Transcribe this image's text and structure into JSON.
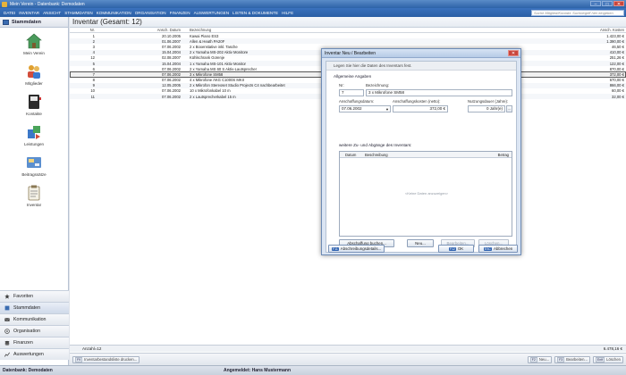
{
  "window": {
    "title": "Mein Verein - Datenbank: Demodaten",
    "controls": [
      "–",
      "□",
      "✕"
    ]
  },
  "menu": {
    "items": [
      "Datei",
      "Inventar",
      "Ansicht",
      "Stammdaten",
      "Kommunikation",
      "Organisation",
      "Finanzen",
      "Auswertungen",
      "Listen & Dokumente",
      "Hilfe"
    ],
    "search_placeholder": "Suche Mitglied/Kontakt: Suchbegriff hier eingeben"
  },
  "sidebar": {
    "header": "Stammdaten",
    "modules": [
      {
        "label": "Mein Verein",
        "icon": "house-icon"
      },
      {
        "label": "Mitglieder",
        "icon": "members-icon"
      },
      {
        "label": "Kontakte",
        "icon": "contacts-icon"
      },
      {
        "label": "Leistungen",
        "icon": "services-icon"
      },
      {
        "label": "Beitragssätze",
        "icon": "fees-icon"
      },
      {
        "label": "Inventar",
        "icon": "inventory-icon"
      }
    ],
    "nav": [
      {
        "label": "Favoriten",
        "icon": "star-icon"
      },
      {
        "label": "Stammdaten",
        "icon": "database-icon"
      },
      {
        "label": "Kommunikation",
        "icon": "mail-icon"
      },
      {
        "label": "Organisation",
        "icon": "organisation-icon"
      },
      {
        "label": "Finanzen",
        "icon": "finance-icon"
      },
      {
        "label": "Auswertungen",
        "icon": "chart-icon"
      }
    ]
  },
  "main": {
    "title": "Inventar (Gesamt: 12)",
    "columns": {
      "nr": "Nr.",
      "date": "Ansch. Datum",
      "desc": "Bezeichnung",
      "cost": "Ansch. Kosten"
    },
    "rows": [
      {
        "nr": "1",
        "date": "20.10.2005",
        "desc": "Kawai Piano ES3",
        "cost": "1.423,00 €"
      },
      {
        "nr": "2",
        "date": "01.06.2007",
        "desc": "Allen & Heath PA20F",
        "cost": "1.390,00 €"
      },
      {
        "nr": "3",
        "date": "07.06.2002",
        "desc": "2 x Boxenstative inkl. Tasche",
        "cost": "46,50 €"
      },
      {
        "nr": "4",
        "date": "15.04.2004",
        "desc": "2 x Yamaha MS-202 Aktiv Monitore",
        "cost": "410,00 €"
      },
      {
        "nr": "12",
        "date": "02.08.2007",
        "desc": "Kühlschrank Gorenje",
        "cost": "251,26 €"
      },
      {
        "nr": "5",
        "date": "15.04.2004",
        "desc": "1 x Yamaha MS-101 Aktiv Monitor",
        "cost": "122,00 €"
      },
      {
        "nr": "6",
        "date": "07.06.2002",
        "desc": "2 x Yamaha MS 60 S Aktiv-Lautsprecher",
        "cost": "870,00 €"
      },
      {
        "nr": "7",
        "date": "07.06.2002",
        "desc": "3 x Mikrofone SM58",
        "cost": "372,00 €"
      },
      {
        "nr": "8",
        "date": "07.06.2002",
        "desc": "4 x Mikrofone AKG C1000S MKII",
        "cost": "670,00 €"
      },
      {
        "nr": "9",
        "date": "12.05.2005",
        "desc": "2 x Mikrofon Stereoset Studio Projects C4 nachbearbeitet",
        "cost": "866,00 €"
      },
      {
        "nr": "10",
        "date": "07.06.2002",
        "desc": "10 x Mikrofonkabel 10 m",
        "cost": "60,00 €"
      },
      {
        "nr": "11",
        "date": "07.06.2002",
        "desc": "2 x Lautsprecherkabel 15 m",
        "cost": "32,00 €"
      }
    ],
    "selected_nr": "7",
    "summary": {
      "count": "Anzahl=12",
      "total": "6.478,16 €"
    },
    "toolbar": {
      "print": {
        "key": "F9",
        "label": "Inventarbestandsliste drucken..."
      },
      "new": {
        "key": "F2",
        "label": "Neu..."
      },
      "edit": {
        "key": "F3",
        "label": "Bearbeiten..."
      },
      "delete": {
        "key": "Entf",
        "label": "Löschen"
      }
    }
  },
  "status": {
    "database": "Datenbank: Demodaten",
    "user": "Angemeldet: Hans Mustermann"
  },
  "dialog": {
    "title": "Inventar Neu / Bearbeiten",
    "hint": "Legen Sie hier die Daten des Inventars fest.",
    "section_general": "Allgemeine Angaben",
    "nr_label": "Nr:",
    "nr_value": "7",
    "desc_label": "Bezeichnung:",
    "desc_value": "3 x Mikrofone SM58",
    "date_label": "Anschaffungsdatum:",
    "date_value": "07.06.2002",
    "cost_label": "Anschaffungskosten (netto):",
    "cost_value": "372,00 €",
    "life_label": "Nutzungsdauer (Jahre):",
    "life_value": "0 Jahr(e)",
    "section_more": "weitere Zu- und Abgänge des Inventars:",
    "sub_columns": {
      "date": "Datum",
      "desc": "Beschreibung",
      "amount": "Betrag"
    },
    "empty": "<Keine Daten anzuzeigen>",
    "buttons": {
      "disposal": "Abschaffung buchen...",
      "new": "Neu...",
      "edit": "Bearbeiten...",
      "delete": "Löschen..."
    },
    "footer": {
      "depreciation": {
        "key": "F11",
        "label": "Abschreibungsdetails..."
      },
      "ok": {
        "key": "F12",
        "label": "OK"
      },
      "cancel": {
        "key": "ESC",
        "label": "Abbrechen"
      }
    }
  },
  "colors": {
    "accent": "#2b5fa5",
    "selection": "#555555"
  }
}
